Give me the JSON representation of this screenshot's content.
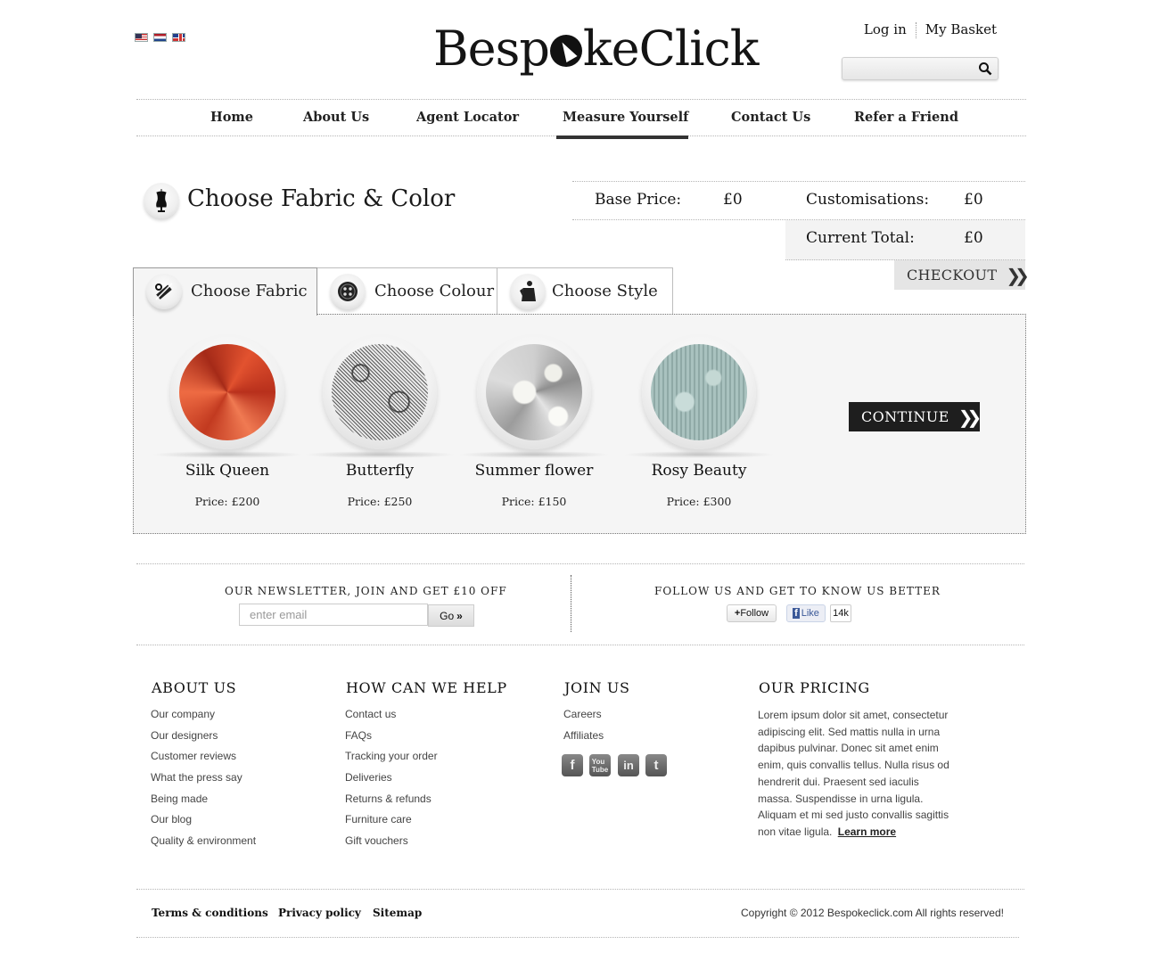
{
  "header": {
    "logo_text_before": "Besp",
    "logo_text_after": "keClick",
    "login": "Log in",
    "basket": "My Basket",
    "search_placeholder": "",
    "flags": [
      "us-flag-icon",
      "nl-flag-icon",
      "uk-flag-icon"
    ]
  },
  "nav": {
    "items": [
      "Home",
      "About Us",
      "Agent Locator",
      "Measure Yourself",
      "Contact Us",
      "Refer a Friend"
    ],
    "active": "Measure Yourself"
  },
  "page": {
    "title": "Choose Fabric & Color",
    "base_price_label": "Base Price:",
    "base_price": "£0",
    "custom_label": "Customisations:",
    "custom_value": "£0",
    "total_label": "Current Total:",
    "total_value": "£0",
    "checkout": "CHECKOUT"
  },
  "tabs": [
    {
      "label": "Choose Fabric",
      "icon": "scissors-icon",
      "active": true
    },
    {
      "label": "Choose Colour",
      "icon": "button-icon",
      "active": false
    },
    {
      "label": "Choose Style",
      "icon": "jacket-icon",
      "active": false
    }
  ],
  "fabrics": [
    {
      "name": "Silk Queen",
      "price": "Price: £200"
    },
    {
      "name": "Butterfly",
      "price": "Price: £250"
    },
    {
      "name": "Summer flower",
      "price": "Price: £150"
    },
    {
      "name": "Rosy Beauty",
      "price": "Price: £300"
    }
  ],
  "continue": "CONTINUE",
  "newsletter": {
    "title": "OUR NEWSLETTER, JOIN AND GET £10 OFF",
    "placeholder": "enter email",
    "go": "Go",
    "follow_title": "FOLLOW US AND GET TO KNOW US BETTER",
    "follow_btn": "Follow",
    "like_btn": "Like",
    "like_count": "14k"
  },
  "footer": {
    "about": {
      "title": "ABOUT US",
      "links": [
        "Our company",
        "Our designers",
        "Customer reviews",
        "What the press say",
        "Being made",
        "Our blog",
        "Quality & environment"
      ]
    },
    "help": {
      "title": "HOW CAN WE HELP",
      "links": [
        "Contact us",
        "FAQs",
        "Tracking your order",
        "Deliveries",
        "Returns & refunds",
        "Furniture care",
        "Gift vouchers"
      ]
    },
    "join": {
      "title": "JOIN US",
      "links": [
        "Careers",
        "Affiliates"
      ],
      "social": [
        "facebook-icon",
        "youtube-icon",
        "linkedin-icon",
        "twitter-icon"
      ]
    },
    "pricing": {
      "title": "OUR PRICING",
      "text": "Lorem ipsum dolor sit amet, consectetur adipiscing elit. Sed mattis nulla in urna dapibus pulvinar. Donec sit amet enim enim, quis convallis tellus. Nulla risus od hendrerit dui. Praesent sed iaculis massa. Suspendisse in urna ligula. Aliquam et mi sed justo convallis sagittis non vitae ligula.",
      "more": "Learn more"
    },
    "legal": [
      "Terms & conditions",
      "Privacy policy",
      "Sitemap"
    ],
    "copyright": "Copyright © 2012 Bespokeclick.com All rights reserved!"
  }
}
